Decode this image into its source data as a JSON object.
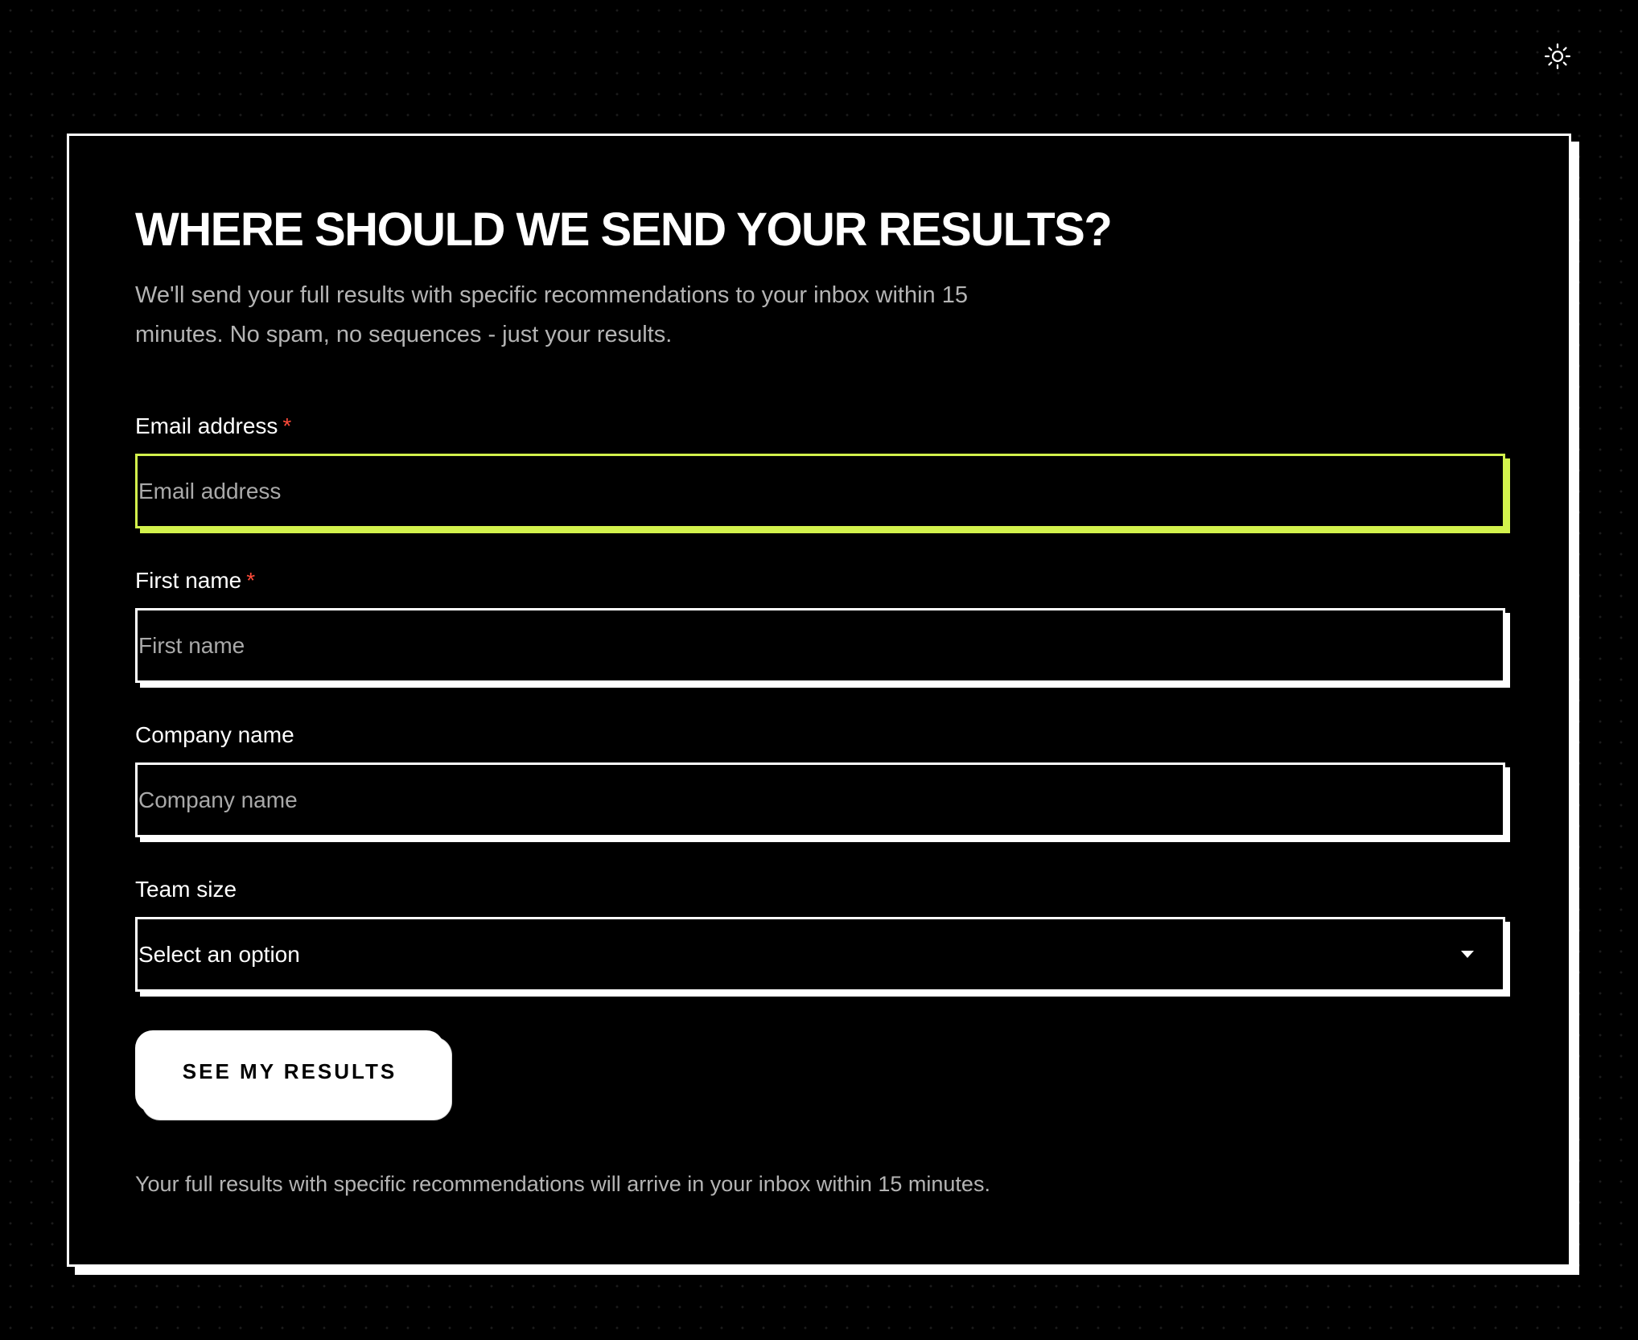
{
  "theme_toggle": {
    "icon": "sun-icon"
  },
  "form": {
    "title": "WHERE SHOULD WE SEND YOUR RESULTS?",
    "subtitle": "We'll send your full results with specific recommendations to your inbox within 15 minutes. No spam, no sequences - just your results.",
    "required_marker": "*",
    "fields": {
      "email": {
        "label": "Email address",
        "required": true,
        "placeholder": "Email address",
        "value": ""
      },
      "first_name": {
        "label": "First name",
        "required": true,
        "placeholder": "First name",
        "value": ""
      },
      "company": {
        "label": "Company name",
        "required": false,
        "placeholder": "Company name",
        "value": ""
      },
      "team_size": {
        "label": "Team size",
        "required": false,
        "selected": "Select an option"
      }
    },
    "submit_label": "SEE MY RESULTS",
    "footnote": "Your full results with specific recommendations will arrive in your inbox within 15 minutes."
  },
  "colors": {
    "background": "#000000",
    "foreground": "#ffffff",
    "accent_focus": "#d3f24c",
    "required": "#ff4b3a",
    "muted_text": "#b4b4b4"
  }
}
